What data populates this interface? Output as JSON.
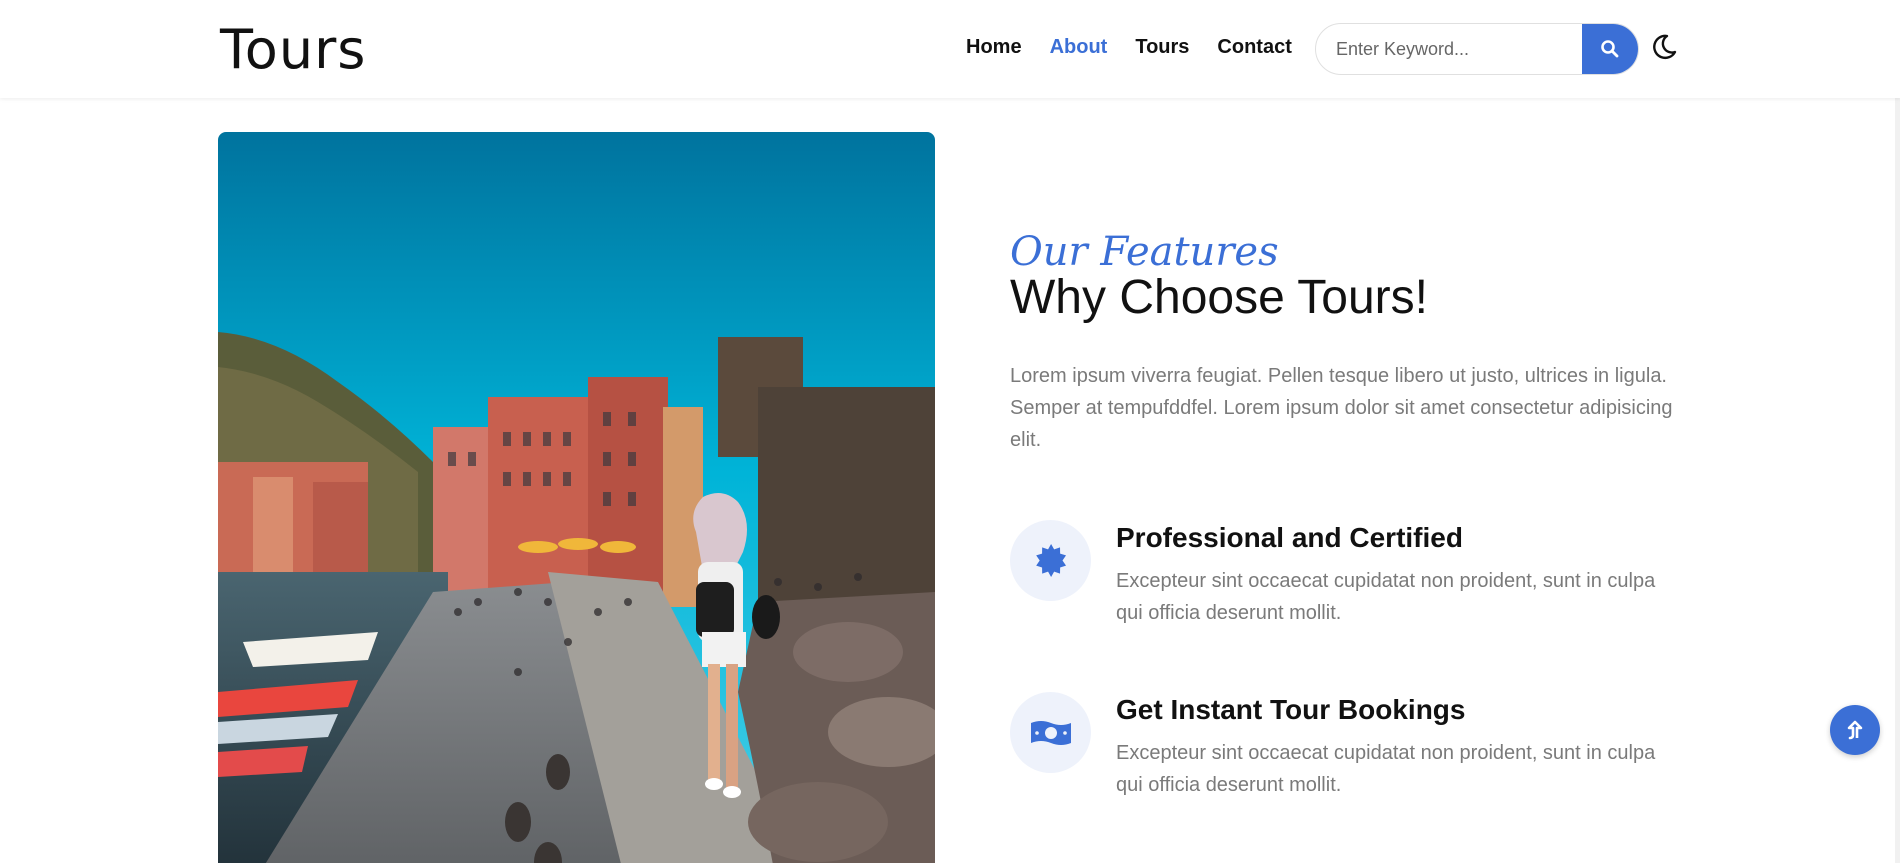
{
  "header": {
    "logo": "Tours",
    "nav": [
      {
        "label": "Home"
      },
      {
        "label": "About"
      },
      {
        "label": "Tours"
      },
      {
        "label": "Contact"
      }
    ],
    "active_nav": "About",
    "search": {
      "placeholder": "Enter Keyword...",
      "value": ""
    },
    "theme_icon": "moon-icon"
  },
  "hero_image": {
    "description_icon": "photo"
  },
  "about": {
    "eyebrow": "Our Features",
    "headline": "Why Choose Tours!",
    "lead": "Lorem ipsum viverra feugiat. Pellen tesque libero ut justo, ultrices in ligula. Semper at tempufddfel. Lorem ipsum dolor sit amet consectetur adipisicing elit."
  },
  "features": [
    {
      "icon": "certificate-badge-icon",
      "title": "Professional and Certified",
      "desc": "Excepteur sint occaecat cupidatat non proident, sunt in culpa qui officia deserunt mollit."
    },
    {
      "icon": "money-bill-icon",
      "title": "Get Instant Tour Bookings",
      "desc": "Excepteur sint occaecat cupidatat non proident, sunt in culpa qui officia deserunt mollit."
    }
  ],
  "colors": {
    "accent": "#3b6fd6",
    "text": "#111111",
    "muted": "#7a7a7a"
  }
}
